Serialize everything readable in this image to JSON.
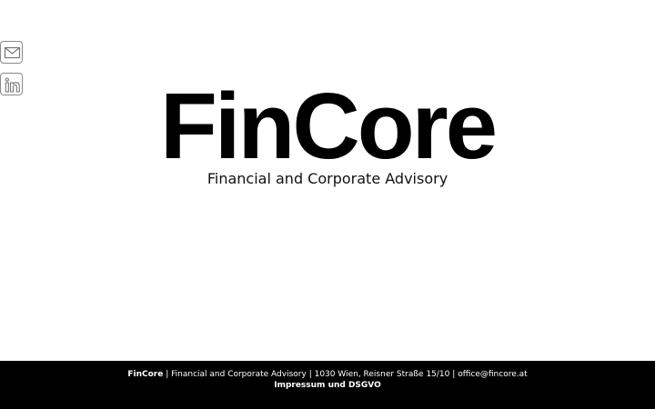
{
  "social": {
    "email_icon": "envelope-icon",
    "linkedin_icon": "linkedin-icon",
    "icon_border_color": "#8a8a8a"
  },
  "hero": {
    "logo": "FinCore",
    "tagline": "Financial and Corporate Advisory"
  },
  "footer": {
    "brand": "FinCore",
    "separator": "|",
    "tagline": "Financial and Corporate Advisory",
    "address": "1030 Wien, Reisner Straße 15/10",
    "email": "office@fincore.at",
    "legal_link": "Impressum und DSGVO",
    "background": "#000000",
    "text_color": "#ffffff"
  }
}
